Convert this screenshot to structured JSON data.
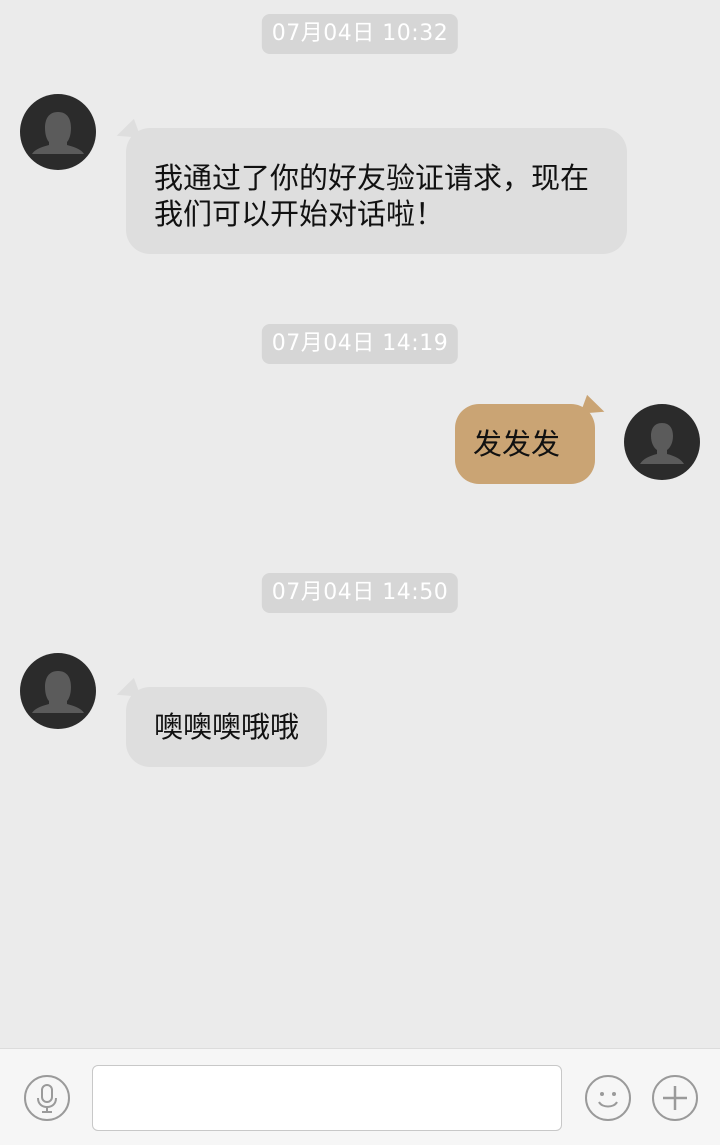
{
  "messages": [
    {
      "timestamp": "07月04日 10:32",
      "direction": "incoming",
      "text": "我通过了你的好友验证请求，现在我们可以开始对话啦！",
      "avatar_icon": "female-user-silhouette-icon"
    },
    {
      "timestamp": "07月04日 14:19",
      "direction": "outgoing",
      "text": "发发发",
      "avatar_icon": "male-user-silhouette-icon"
    },
    {
      "timestamp": "07月04日 14:50",
      "direction": "incoming",
      "text": "噢噢噢哦哦",
      "avatar_icon": "female-user-silhouette-icon"
    }
  ],
  "input_bar": {
    "voice_icon": "microphone-icon",
    "text_value": "",
    "emoji_icon": "smiley-face-icon",
    "more_icon": "plus-icon"
  },
  "colors": {
    "background": "#ebebeb",
    "timestamp_bg": "#d6d6d6",
    "incoming_bubble": "#dedede",
    "outgoing_bubble": "#caa474",
    "avatar_bg": "#2b2b2b",
    "input_bar_bg": "#f6f6f6"
  }
}
